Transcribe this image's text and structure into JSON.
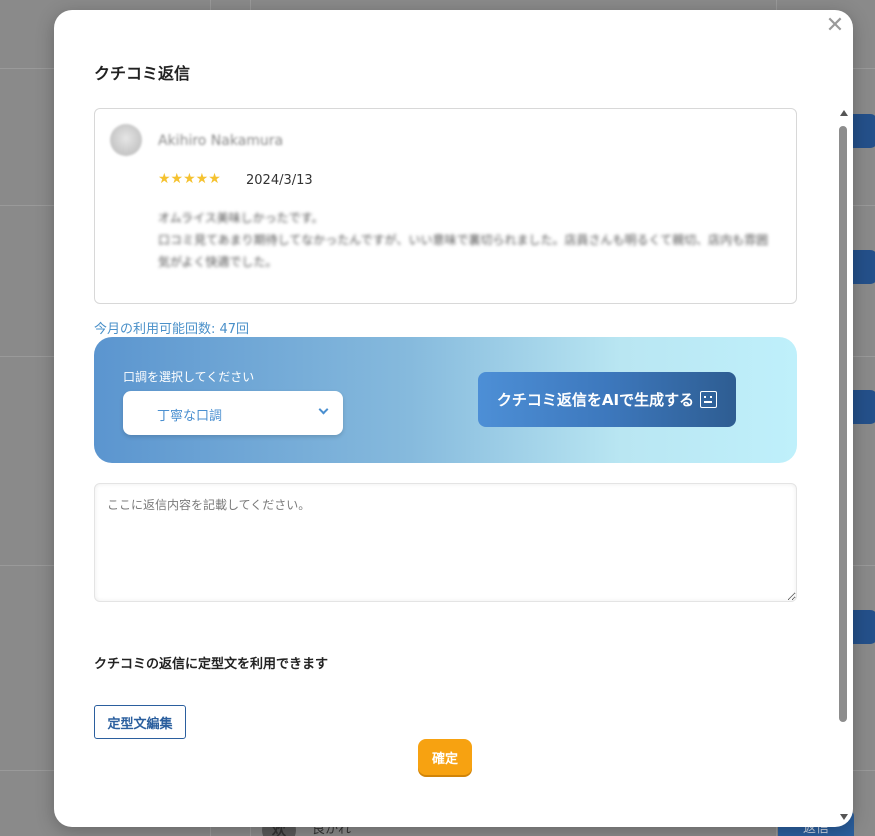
{
  "modal": {
    "title": "クチコミ返信",
    "close_icon": "✕"
  },
  "review": {
    "reviewer_name": "Akihiro Nakamura",
    "rating": 5,
    "stars": "★★★★★",
    "date": "2024/3/13",
    "body": "オムライス美味しかったです。\n口コミ見てあまり期待してなかったんですが、いい意味で裏切られました。店員さんも明るくて親切、店内も雰囲気がよく快適でした。"
  },
  "usage": {
    "text": "今月の利用可能回数: 47回"
  },
  "ai_panel": {
    "tone_label": "口調を選択してください",
    "tone_selected": "丁寧な口調",
    "generate_label": "クチコミ返信をAIで生成する",
    "generate_icon": "robot-icon"
  },
  "reply": {
    "placeholder": "ここに返信内容を記載してください。",
    "value": ""
  },
  "templates": {
    "note": "クチコミの返信に定型文を利用できます",
    "edit_label": "定型文編集"
  },
  "footer": {
    "confirm_label": "確定"
  },
  "background": {
    "bottom_avatar_text": "欢",
    "bottom_text": "良かれ",
    "bottom_button": "返信"
  },
  "colors": {
    "accent_blue": "#2b5f9e",
    "link_blue": "#4a90c9",
    "confirm_orange": "#f7a211",
    "star_yellow": "#f5c230"
  }
}
